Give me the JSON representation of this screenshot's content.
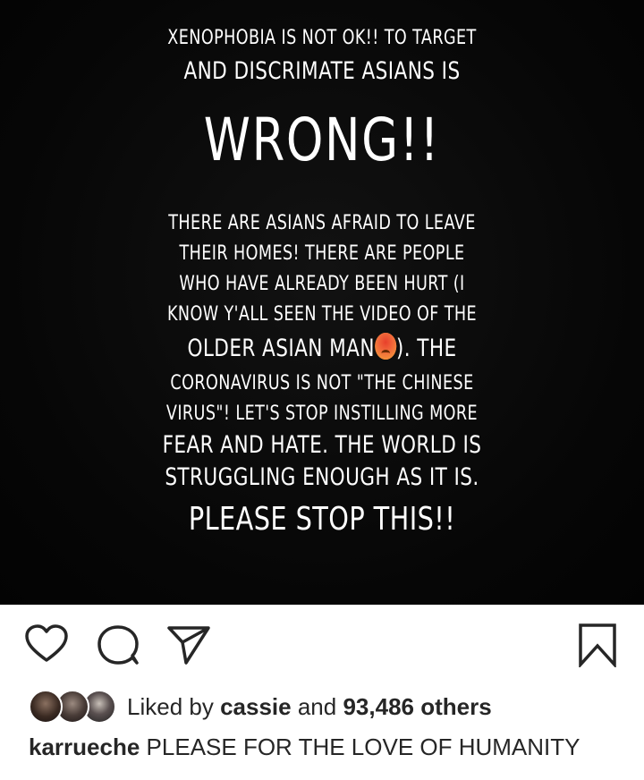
{
  "post": {
    "lines": [
      "XENOPHOBIA IS NOT OK!! TO TARGET",
      "AND DISCRIMATE ASIANS IS",
      "WRONG!!",
      "THERE ARE ASIANS AFRAID TO LEAVE",
      "THEIR HOMES! THERE ARE PEOPLE",
      "WHO HAVE ALREADY BEEN HURT (I",
      "KNOW Y'ALL SEEN THE VIDEO OF THE",
      "OLDER ASIAN MAN",
      "). THE",
      "CORONAVIRUS IS NOT \"THE CHINESE",
      "VIRUS\"! LET'S STOP INSTILLING MORE",
      "FEAR AND HATE. THE WORLD IS",
      "STRUGGLING ENOUGH AS IT IS.",
      "PLEASE STOP THIS!!"
    ]
  },
  "likes": {
    "prefix": "Liked by",
    "user": "cassie",
    "conjunction": "and",
    "count": "93,486 others"
  },
  "caption": {
    "username": "karrueche",
    "text": "PLEASE FOR THE LOVE OF HUMANITY"
  },
  "icons": [
    "heart-icon",
    "comment-icon",
    "share-icon",
    "bookmark-icon",
    "angry-emoji-icon"
  ]
}
